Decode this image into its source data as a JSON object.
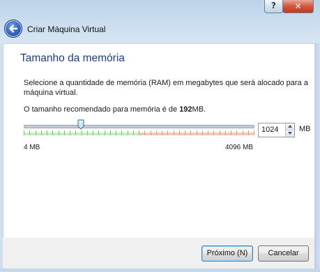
{
  "window": {
    "title": "Criar Máquina Virtual",
    "help_label": "?",
    "close_label": "✕"
  },
  "page": {
    "heading": "Tamanho da memória",
    "description": "Selecione a quantidade de memória (RAM) em megabytes que será alocado para a máquina virtual.",
    "recommended_prefix": "O tamanho recomendado para memória é de ",
    "recommended_value": "192",
    "recommended_suffix": "MB."
  },
  "memory": {
    "value": "1024",
    "unit": "MB",
    "min_label": "4 MB",
    "max_label": "4096 MB",
    "min": 4,
    "max": 4096,
    "current": 1024,
    "recommended_max_fraction": 0.5
  },
  "colors": {
    "heading": "#1e3e8a",
    "slider_green": "#c6f0bf",
    "slider_red": "#f4c6bc"
  },
  "buttons": {
    "next_label": "Próximo (N)",
    "cancel_label": "Cancelar"
  }
}
